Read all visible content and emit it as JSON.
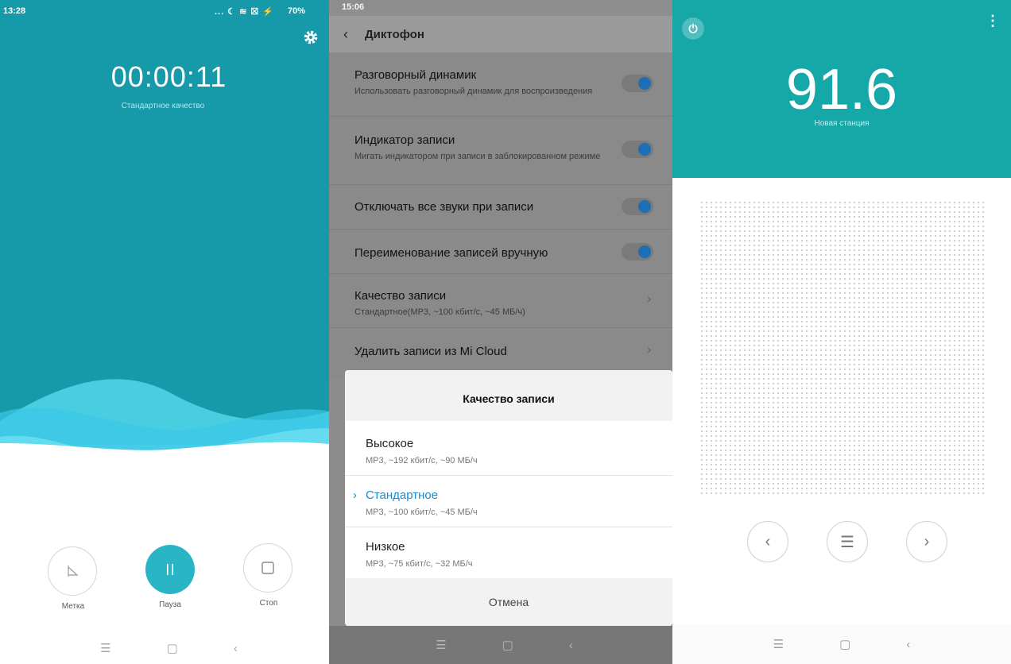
{
  "recorder": {
    "status_time": "13:28",
    "status_right": "... ☾ ≋ ☒ ⚡",
    "battery": "70%",
    "timer": "00:00:11",
    "quality": "Стандартное качество",
    "buttons": {
      "mark": "Метка",
      "pause": "Пауза",
      "stop": "Стоп"
    },
    "colors": {
      "header": "#1699a9",
      "pause": "#2ab5c6"
    }
  },
  "settings": {
    "status_time": "15:06",
    "title": "Диктофон",
    "rows": [
      {
        "title": "Разговорный динамик",
        "subtitle": "Использовать разговорный динамик для воспроизведения"
      },
      {
        "title": "Индикатор записи",
        "subtitle": "Мигать индикатором при записи в заблокированном режиме"
      },
      {
        "title": "Отключать все звуки при записи"
      },
      {
        "title": "Переименование записей вручную"
      },
      {
        "title": "Качество записи",
        "subtitle": "Стандартное(MP3, ~100 кбит/с, ~45 МБ/ч)"
      },
      {
        "title": "Удалить записи из Mi Cloud"
      }
    ],
    "dialog": {
      "title": "Качество записи",
      "options": [
        {
          "name": "Высокое",
          "desc": "MP3, ~192 кбит/с, ~90 МБ/ч"
        },
        {
          "name": "Стандартное",
          "desc": "MP3, ~100 кбит/с, ~45 МБ/ч"
        },
        {
          "name": "Низкое",
          "desc": "MP3, ~75 кбит/с, ~32 МБ/ч"
        }
      ],
      "selected_index": 1,
      "cancel": "Отмена"
    }
  },
  "radio": {
    "frequency": "91.6",
    "station": "Новая станция",
    "colors": {
      "header": "#16a7a9"
    }
  }
}
